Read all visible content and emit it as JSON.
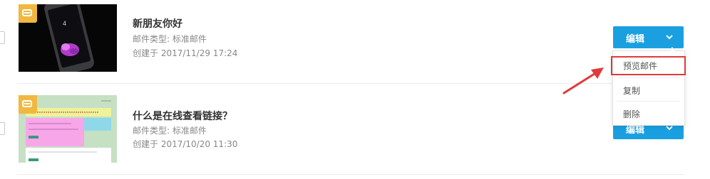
{
  "emails": [
    {
      "title": "新朋友你好",
      "type_text": "邮件类型: 标准邮件",
      "created_text": "创建于 2017/11/29 17:24",
      "edit_label": "编辑"
    },
    {
      "title": "什么是在线查看链接？",
      "type_text": "邮件类型: 标准邮件",
      "created_text": "创建于 2017/10/20 11:30",
      "edit_label": "编辑"
    }
  ],
  "dropdown": {
    "items": [
      {
        "label": "预览邮件"
      },
      {
        "label": "复制"
      },
      {
        "label": "删除"
      }
    ]
  },
  "colors": {
    "accent": "#1aa0e0",
    "tag": "#f0b840",
    "annotation": "#e03a3a"
  },
  "icons": [
    "mail-tag-icon",
    "chevron-down-icon",
    "annotation-arrow-icon"
  ]
}
